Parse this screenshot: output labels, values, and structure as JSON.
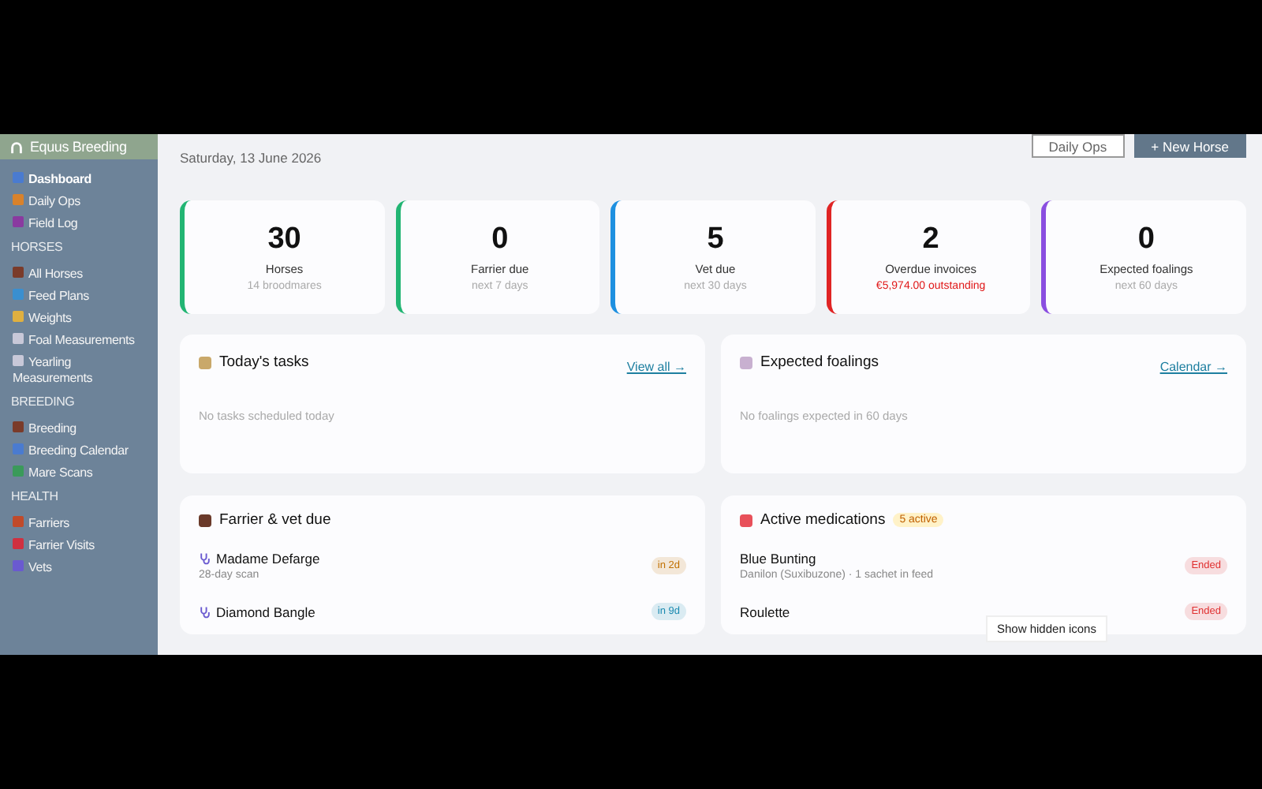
{
  "sidebar": {
    "brand": "Equus Breeding",
    "sections": [
      {
        "items": [
          {
            "label": "Dashboard",
            "selected": true,
            "color": "#4a7bd0"
          },
          {
            "label": "Daily Ops",
            "selected": false,
            "color": "#d9822b"
          },
          {
            "label": "Field Log",
            "selected": false,
            "color": "#8a3aa0"
          }
        ]
      },
      {
        "heading": "HORSES",
        "items": [
          {
            "label": "All Horses",
            "selected": false,
            "color": "#7a3b2a"
          },
          {
            "label": "Feed Plans",
            "selected": false,
            "color": "#3a8fd0"
          },
          {
            "label": "Weights",
            "selected": false,
            "color": "#e0b040"
          },
          {
            "label": "Foal Measurements",
            "selected": false,
            "color": "#c8c8d8"
          },
          {
            "label": "Yearling Measurements",
            "selected": false,
            "color": "#c8c8d8"
          }
        ]
      },
      {
        "heading": "BREEDING",
        "items": [
          {
            "label": "Breeding",
            "selected": false,
            "color": "#7a3b2a"
          },
          {
            "label": "Breeding Calendar",
            "selected": false,
            "color": "#4a7bd0"
          },
          {
            "label": "Mare Scans",
            "selected": false,
            "color": "#3a9a5a"
          }
        ]
      },
      {
        "heading": "HEALTH",
        "items": [
          {
            "label": "Farriers",
            "selected": false,
            "color": "#c04a2a"
          },
          {
            "label": "Farrier Visits",
            "selected": false,
            "color": "#d03040"
          },
          {
            "label": "Vets",
            "selected": false,
            "color": "#6a5ad0"
          }
        ]
      }
    ]
  },
  "date": "Saturday, 13 June 2026",
  "actions": [
    {
      "label": "Daily Ops",
      "kind": "outline"
    },
    {
      "label": "+ New Horse",
      "kind": "solid"
    }
  ],
  "stats": [
    {
      "value": "30",
      "label": "Horses",
      "note": "14 broodmares",
      "color": "#22b573",
      "alert": false
    },
    {
      "value": "0",
      "label": "Farrier due",
      "note": "next 7 days",
      "color": "#22b573",
      "alert": false
    },
    {
      "value": "5",
      "label": "Vet due",
      "note": "next 30 days",
      "color": "#1e90e0",
      "alert": false
    },
    {
      "value": "2",
      "label": "Overdue invoices",
      "note": "€5,974.00 outstanding",
      "color": "#e02424",
      "alert": true
    },
    {
      "value": "0",
      "label": "Expected foalings",
      "note": "next 60 days",
      "color": "#8a4ee0",
      "alert": false
    }
  ],
  "panels": [
    {
      "title": "Today's tasks",
      "link": "View all →",
      "empty": "No tasks scheduled today"
    },
    {
      "title": "Expected foalings",
      "link": "Calendar →",
      "empty": "No foalings expected in 60 days"
    },
    {
      "title": "Farrier & vet due",
      "rows": [
        {
          "name": "Madame Defarge",
          "detail": "28-day scan",
          "badge": "in 2d",
          "color": "#c07000"
        },
        {
          "name": "Diamond Bangle",
          "badge": "in 9d",
          "color": "#1a8ab0"
        }
      ]
    },
    {
      "title": "Active medications",
      "count": "5 active",
      "rows": [
        {
          "name": "Blue Bunting",
          "detail": "Danilon (Suxibuzone) · 1 sachet in feed",
          "badge": "Ended",
          "color": "#e03030"
        },
        {
          "name": "Roulette",
          "badge": "Ended",
          "color": "#e03030"
        }
      ]
    }
  ],
  "tooltip": "Show hidden icons"
}
